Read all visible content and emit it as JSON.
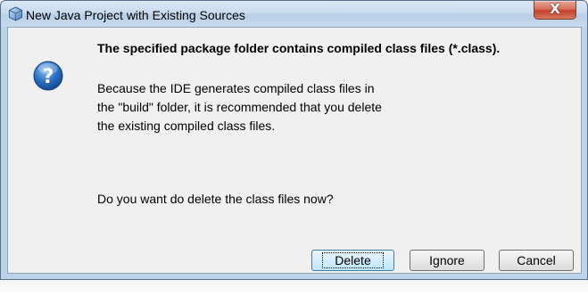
{
  "window": {
    "title": "New Java Project with Existing Sources",
    "close_label": "X"
  },
  "dialog": {
    "heading": "The specified package folder contains compiled class files (*.class).",
    "paragraph_lines": [
      "Because the IDE generates compiled class files in",
      "the \"build\" folder, it is recommended that you delete",
      "the existing compiled class files."
    ],
    "question": "Do you want do delete the class files now?"
  },
  "buttons": {
    "delete": "Delete",
    "ignore": "Ignore",
    "cancel": "Cancel"
  },
  "icons": {
    "title": "netbeans-cube-icon",
    "message": "question-icon"
  },
  "colors": {
    "accent_blue": "#1f63b5",
    "close_red": "#c7402a",
    "dialog_bg": "#f0f0f0"
  }
}
